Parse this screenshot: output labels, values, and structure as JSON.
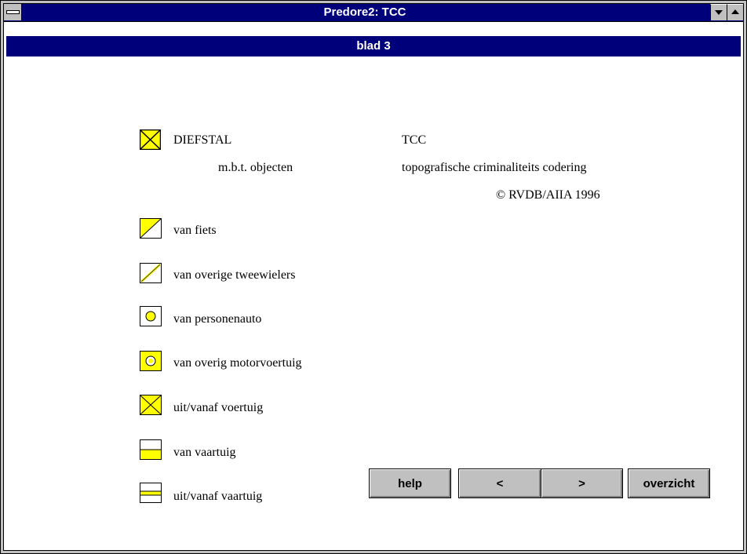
{
  "window": {
    "title": "Predore2: TCC"
  },
  "page": {
    "title": "blad 3"
  },
  "header": {
    "main_label": "DIEFSTAL",
    "sub_label": "m.b.t. objecten",
    "tcc": "TCC",
    "tcc_full": "topografische criminaliteits codering",
    "copyright": "© RVDB/AIIA 1996"
  },
  "legend": [
    {
      "label": "van fiets",
      "icon": "diagonal-filled-icon"
    },
    {
      "label": "van overige tweewielers",
      "icon": "diagonal-outline-icon"
    },
    {
      "label": "van personenauto",
      "icon": "circle-filled-icon"
    },
    {
      "label": "van overig motorvoertuig",
      "icon": "circle-outline-icon"
    },
    {
      "label": "uit/vanaf voertuig",
      "icon": "cross-icon"
    },
    {
      "label": "van vaartuig",
      "icon": "bottom-half-icon"
    },
    {
      "label": "uit/vanaf vaartuig",
      "icon": "middle-band-icon"
    }
  ],
  "buttons": {
    "help": "help",
    "prev": "<",
    "next": ">",
    "overview": "overzicht"
  },
  "colors": {
    "symbol_yellow": "#ffff00",
    "title_blue": "#00007b"
  }
}
